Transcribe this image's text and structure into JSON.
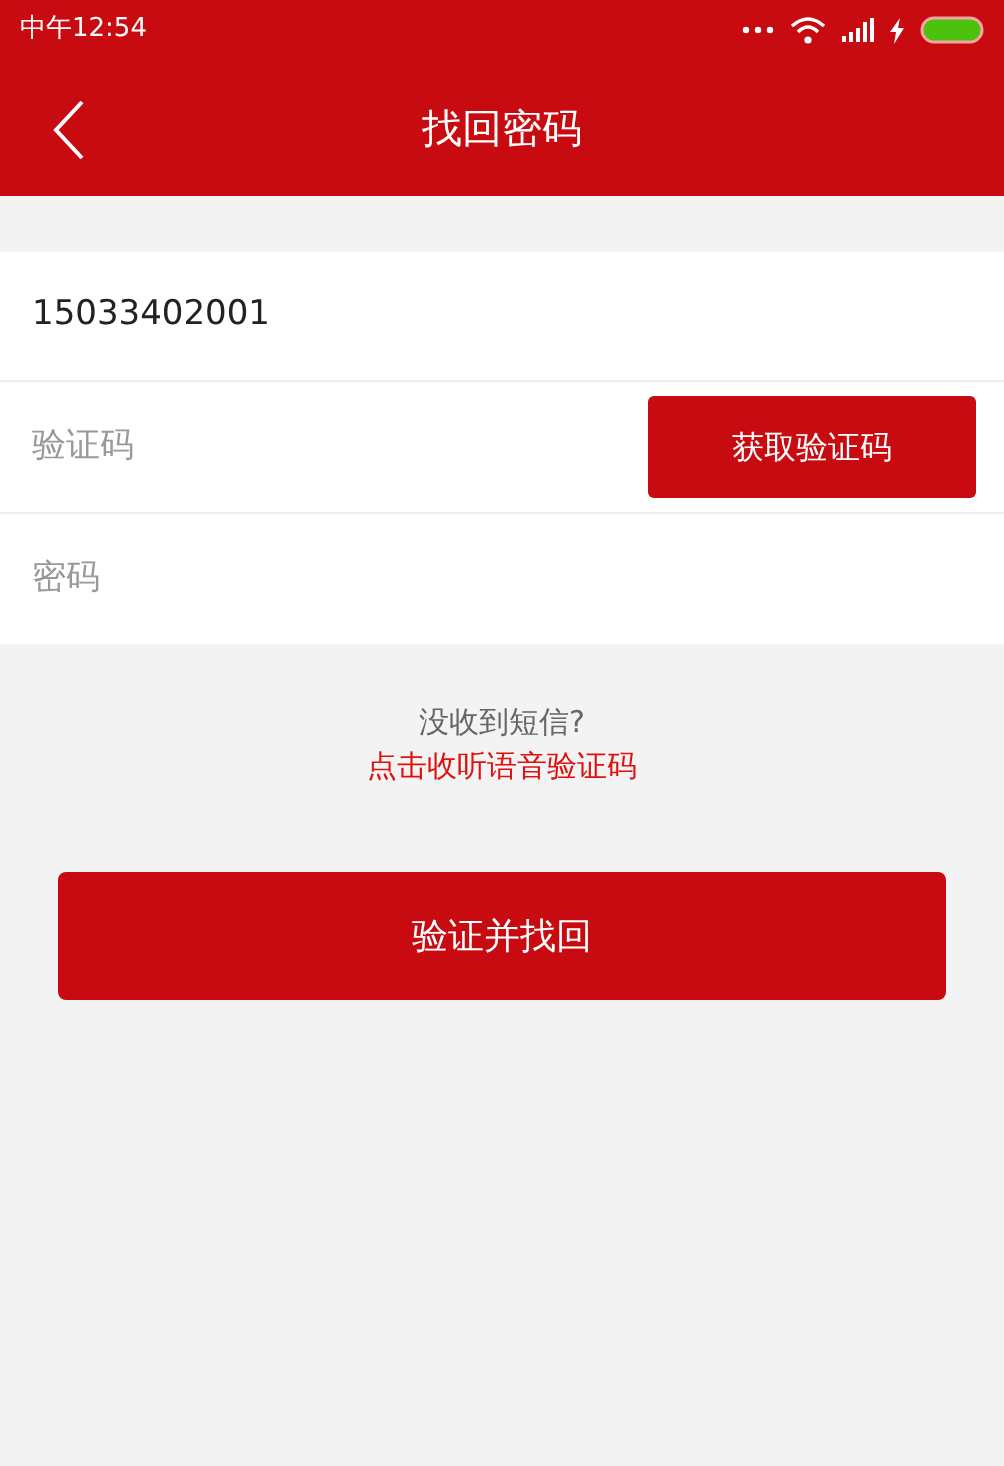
{
  "status_bar": {
    "time": "中午12:54"
  },
  "header": {
    "title": "找回密码"
  },
  "form": {
    "phone": {
      "value": "15033402001"
    },
    "code": {
      "placeholder": "验证码"
    },
    "get_code_button": "获取验证码",
    "password": {
      "placeholder": "密码"
    }
  },
  "voice_hint": {
    "question": "没收到短信?",
    "link": "点击收听语音验证码"
  },
  "submit_button": "验证并找回"
}
